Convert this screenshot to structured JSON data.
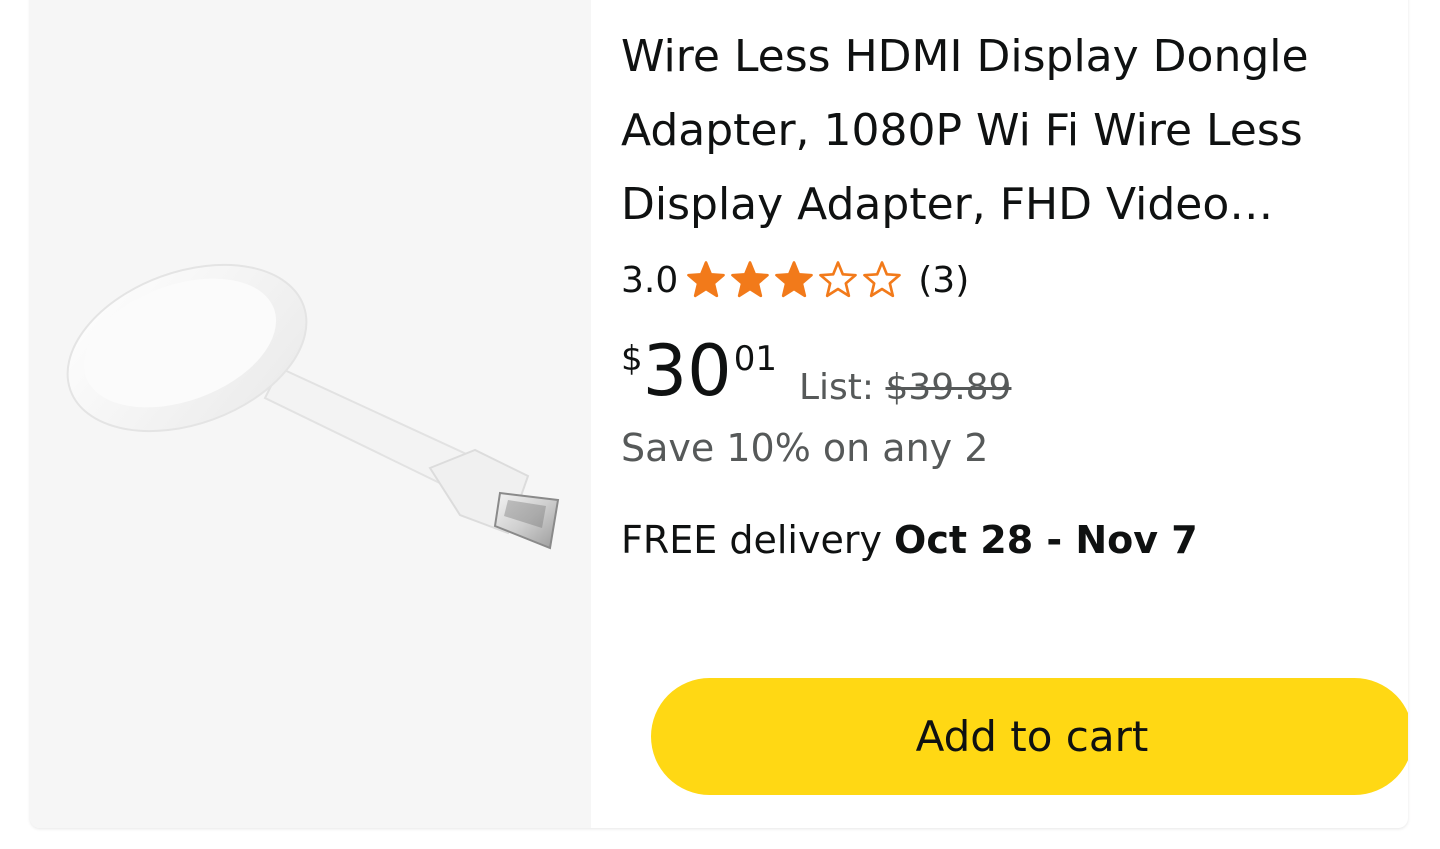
{
  "product": {
    "title": "Wire Less HDMI Display Dongle\nAdapter, 1080P Wi Fi Wire Less\nDisplay Adapter, FHD Video…",
    "rating": {
      "value_text": "3.0",
      "stars_filled": 3,
      "stars_total": 5,
      "count_text": "(3)",
      "star_color": "#f27a1a"
    },
    "price": {
      "symbol": "$",
      "whole": "30",
      "fraction": "01",
      "list_label": "List:",
      "list_value": "$39.89"
    },
    "promo": "Save 10% on any 2",
    "delivery": {
      "prefix": "FREE delivery",
      "date": "Oct 28 - Nov 7"
    },
    "add_to_cart_label": "Add to cart",
    "button_color": "#ffd814",
    "image_icon": "hdmi-dongle-icon"
  }
}
